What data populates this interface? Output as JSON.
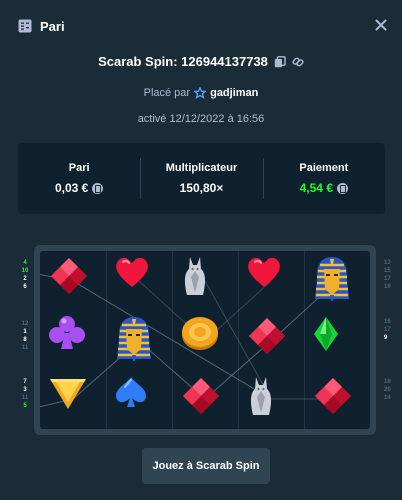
{
  "header": {
    "title": "Pari",
    "icon": "bet-slip-icon",
    "close_icon": "close-icon"
  },
  "spin": {
    "title": "Scarab Spin: 126944137738",
    "copy_icon": "copy-icon",
    "link_icon": "link-icon"
  },
  "placed": {
    "prefix": "Placé par",
    "user": "gadjiman",
    "badge_icon": "star-badge-icon"
  },
  "activated": "activé 12/12/2022 à 16:56",
  "stats": {
    "bet": {
      "label": "Pari",
      "value": "0,03 €"
    },
    "multiplier": {
      "label": "Multiplicateur",
      "value": "150,80×"
    },
    "payout": {
      "label": "Paiement",
      "value": "4,54 €",
      "color": "#1fff20"
    }
  },
  "board": {
    "rows": [
      [
        "red-diamond",
        "red-heart",
        "silver-cat",
        "red-heart",
        "pharaoh"
      ],
      [
        "purple-club",
        "pharaoh",
        "gold-coin",
        "red-diamond",
        "green-diamond"
      ],
      [
        "yellow-triangle",
        "blue-spade",
        "red-diamond",
        "silver-cat",
        "red-diamond"
      ]
    ],
    "left_lines": [
      [
        {
          "t": "4",
          "s": "hi"
        },
        {
          "t": "10",
          "s": "hi"
        },
        {
          "t": "2",
          "s": ""
        },
        {
          "t": "6",
          "s": ""
        }
      ],
      [
        {
          "t": "12",
          "s": "dim"
        },
        {
          "t": "1",
          "s": ""
        },
        {
          "t": "8",
          "s": ""
        },
        {
          "t": "11",
          "s": "dim"
        }
      ],
      [
        {
          "t": "7",
          "s": ""
        },
        {
          "t": "3",
          "s": ""
        },
        {
          "t": "11",
          "s": "dim"
        },
        {
          "t": "5",
          "s": "hi"
        }
      ]
    ],
    "right_lines": [
      [
        {
          "t": "13",
          "s": "dim"
        },
        {
          "t": "15",
          "s": "dim"
        },
        {
          "t": "17",
          "s": "dim"
        },
        {
          "t": "19",
          "s": "dim"
        }
      ],
      [
        {
          "t": "16",
          "s": "dim"
        },
        {
          "t": "17",
          "s": "dim"
        },
        {
          "t": "9",
          "s": ""
        }
      ],
      [
        {
          "t": "18",
          "s": "dim"
        },
        {
          "t": "20",
          "s": "dim"
        },
        {
          "t": "14",
          "s": "dim"
        }
      ]
    ]
  },
  "play_button": "Jouez à Scarab Spin"
}
